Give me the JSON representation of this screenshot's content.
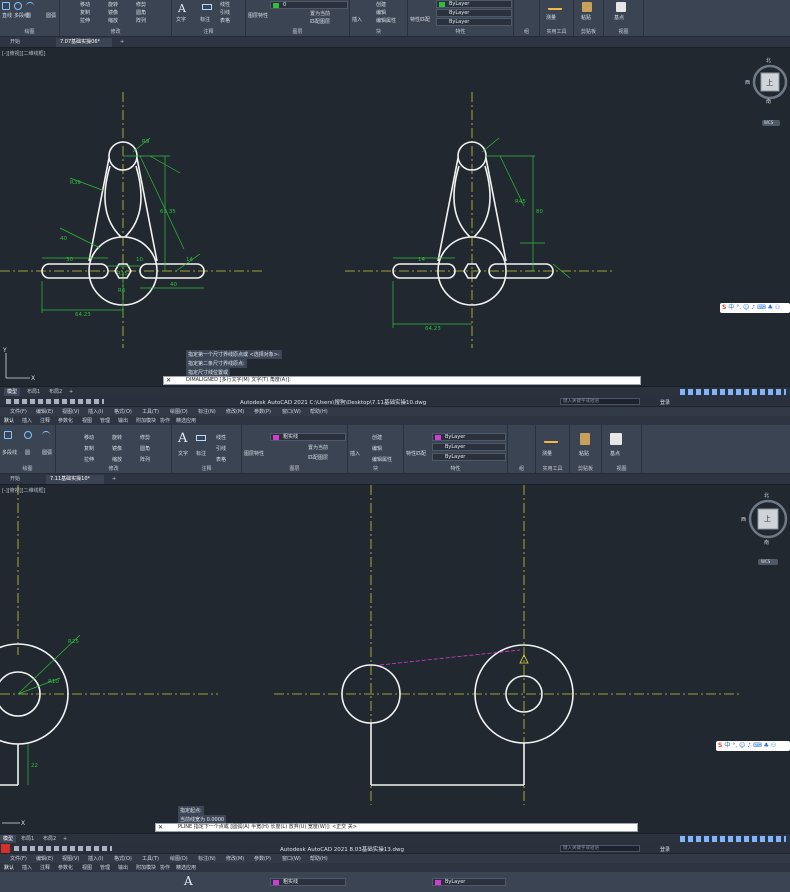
{
  "top": {
    "ribbon_groups": [
      "绘图",
      "修改",
      "注释",
      "图层",
      "块",
      "特性",
      "组",
      "实用工具",
      "剪贴板",
      "视图"
    ],
    "draw_tools": [
      "直线",
      "多段线",
      "圆",
      "圆弧"
    ],
    "modify_tools": [
      "移动",
      "旋转",
      "修剪",
      "复制",
      "镜像",
      "圆角",
      "拉伸",
      "缩放",
      "阵列"
    ],
    "annot_tools": [
      "文字",
      "标注",
      "线性",
      "引线",
      "表格"
    ],
    "layer_tools": [
      "图层特性",
      "置为当前",
      "匹配图层"
    ],
    "block_tools": [
      "插入",
      "创建",
      "编辑",
      "编辑属性"
    ],
    "prop_tools": [
      "特性匹配"
    ],
    "util_tools": [
      "测量"
    ],
    "clip_tools": [
      "粘贴"
    ],
    "view_tools": [
      "基点"
    ],
    "layer_value": "0",
    "bylayer_1": "ByLayer",
    "bylayer_2": "ByLayer",
    "bylayer_3": "ByLayer",
    "tabs": [
      "开始",
      "7.07基础实操06*"
    ],
    "tab_plus": "+",
    "viewport_label": "[-][俯视][二维线框]",
    "cmd_history": [
      "指定第一个尺寸界线原点或 <选择对象>:",
      "指定第二条尺寸界线原点:",
      "指定尺寸线位置或"
    ],
    "cmd_prompt": "DIMALIGNED [多行文字(M) 文字(T) 角度(A)]:",
    "layout_tabs": [
      "模型",
      "布局1",
      "布局2"
    ],
    "layout_plus": "+",
    "dims": [
      "R9",
      "R39",
      "40",
      "63.35",
      "30",
      "R15",
      "14",
      "40",
      "10",
      "R6",
      "64.23",
      "14",
      "R45",
      "80",
      "64.23"
    ],
    "viewcube": {
      "north": "北",
      "south": "南",
      "west": "西",
      "east": "东",
      "face": "上",
      "wcs": "WCS"
    }
  },
  "bottom": {
    "title": "Autodesk AutoCAD 2021    C:\\Users\\搜狗\\Desktop\\7.11基础实操10.dwg",
    "search_placeholder": "键入关键字或短语",
    "login": "登录",
    "menus": [
      "文件(F)",
      "编辑(E)",
      "视图(V)",
      "插入(I)",
      "格式(O)",
      "工具(T)",
      "绘图(D)",
      "标注(N)",
      "修改(M)",
      "参数(P)",
      "窗口(W)",
      "帮助(H)"
    ],
    "ribbon_tabs": [
      "默认",
      "插入",
      "注释",
      "参数化",
      "视图",
      "管理",
      "输出",
      "附加模块",
      "协作",
      "精选应用"
    ],
    "ribbon_groups": [
      "绘图",
      "修改",
      "注释",
      "图层",
      "块",
      "特性",
      "组",
      "实用工具",
      "剪贴板",
      "视图"
    ],
    "draw_tools": [
      "多段线",
      "圆",
      "圆弧"
    ],
    "modify_tools": [
      "移动",
      "旋转",
      "修剪",
      "复制",
      "镜像",
      "圆角",
      "拉伸",
      "缩放",
      "阵列"
    ],
    "annot_tools": [
      "文字",
      "标注",
      "线性",
      "引线",
      "表格"
    ],
    "layer_tools": [
      "图层特性",
      "置为当前",
      "匹配图层"
    ],
    "block_tools": [
      "插入",
      "创建",
      "编辑",
      "编辑属性"
    ],
    "prop_tools": [
      "特性匹配"
    ],
    "util_tools": [
      "测量"
    ],
    "clip_tools": [
      "粘贴"
    ],
    "view_tools": [
      "基点"
    ],
    "layer_value": "粗实线",
    "bylayer_1": "ByLayer",
    "bylayer_2": "ByLayer",
    "bylayer_3": "ByLayer",
    "tabs": [
      "开始",
      "7.11基础实操10*"
    ],
    "tab_plus": "+",
    "viewport_label": "[-][俯视][二维线框]",
    "cmd_history": [
      "指定起点:",
      "当前线宽为 0.0000"
    ],
    "cmd_prompt": "PLINE 指定下一个点或 [圆弧(A) 半宽(H) 长度(L) 放弃(U) 宽度(W)]: <正交 关>",
    "layout_tabs": [
      "模型",
      "布局1",
      "布局2"
    ],
    "layout_plus": "+",
    "dims": [
      "R25",
      "R10",
      "22"
    ],
    "viewcube": {
      "north": "北",
      "south": "南",
      "west": "西",
      "east": "东",
      "face": "上",
      "wcs": "WCS"
    },
    "next_title": "Autodesk AutoCAD 2021    8.03基础实操13.dwg",
    "next_search_placeholder": "键入关键字或短语",
    "next_login": "登录",
    "next_layer_value": "粗实线"
  },
  "ime": {
    "s_logo": "S",
    "items": [
      "中",
      "°,",
      "☺",
      "♪",
      "⌨",
      "♣",
      "⚇"
    ]
  },
  "colors": {
    "canvas": "#212830",
    "ribbon": "#3b4453",
    "dimension": "#2fbf3a",
    "centerline": "#c8c83a",
    "geometry": "#f2f2f2",
    "accent_magenta": "#d23cd2"
  }
}
